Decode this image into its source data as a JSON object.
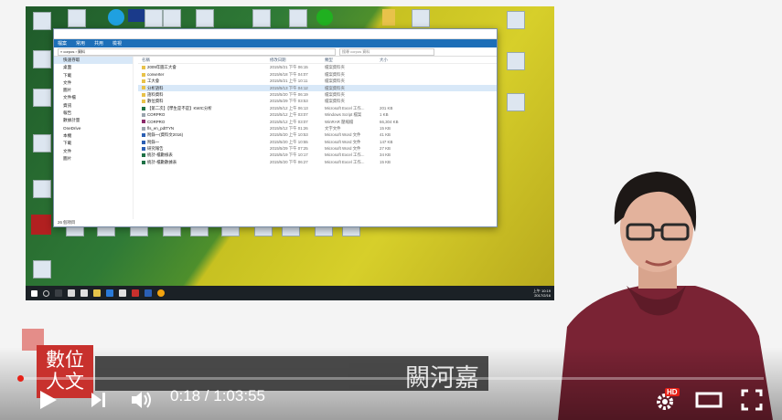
{
  "explorer": {
    "ribbon_tabs": [
      "檔案",
      "常用",
      "共用",
      "檢視"
    ],
    "address": "« corpos › 資料",
    "search_placeholder": "搜尋 corpos 資料",
    "column_headers": [
      "名稱",
      "修改日期",
      "類型",
      "大小"
    ],
    "nav_items": [
      "快速存取",
      "桌面",
      "下載",
      "文件",
      "圖片",
      "文件檔",
      "資訊",
      "報告",
      "數據計量",
      "OneDrive",
      "本機",
      "下載",
      "文件",
      "圖片"
    ],
    "files": [
      {
        "name": "2009年圖工大會",
        "date": "2015/5/21 下午 06:15",
        "type": "檔案資料夾",
        "size": ""
      },
      {
        "name": "converter",
        "date": "2015/6/18 下午 04:07",
        "type": "檔案資料夾",
        "size": ""
      },
      {
        "name": "工大會",
        "date": "2015/5/21 上午 10:11",
        "type": "檔案資料夾",
        "size": ""
      },
      {
        "name": "分析語料",
        "date": "2015/5/13 下午 04:12",
        "type": "檔案資料夾",
        "size": ""
      },
      {
        "name": "語料資料",
        "date": "2015/5/20 下午 06:19",
        "type": "檔案資料夾",
        "size": ""
      },
      {
        "name": "數位資料",
        "date": "2015/5/29 下午 03:53",
        "type": "檔案資料夾",
        "size": ""
      },
      {
        "name": "【第二次】【學生是不是】KWIC分析",
        "date": "2015/5/12 上午 06:13",
        "type": "Microsoft Excel 工作...",
        "size": "201 KB"
      },
      {
        "name": "CORPRO",
        "date": "2015/5/12 上午 03:07",
        "type": "Windows Script 檔案",
        "size": "1 KB"
      },
      {
        "name": "CORPRO",
        "date": "2015/5/12 上午 03:07",
        "type": "WinRAR 壓縮檔",
        "size": "66,304 KB"
      },
      {
        "name": "fls_en_pdtTYN",
        "date": "2015/5/12 下午 01:26",
        "type": "文字文件",
        "size": "15 KB"
      },
      {
        "name": "附錄一(資料文2016)",
        "date": "2015/5/20 上午 10:53",
        "type": "Microsoft Word 文件",
        "size": "41 KB"
      },
      {
        "name": "附錄一",
        "date": "2015/5/20 上午 10:55",
        "type": "Microsoft Word 文件",
        "size": "147 KB"
      },
      {
        "name": "研究報告",
        "date": "2015/5/29 下午 07:25",
        "type": "Microsoft Word 文件",
        "size": "27 KB"
      },
      {
        "name": "統計-檔數檢表",
        "date": "2015/5/19 下午 10:17",
        "type": "Microsoft Excel 工作...",
        "size": "34 KB"
      },
      {
        "name": "統計-檔數數據表",
        "date": "2015/5/20 下午 06:27",
        "type": "Microsoft Excel 工作...",
        "size": "15 KB"
      }
    ],
    "status_bar": "26 個項目"
  },
  "desktop_icons": [
    "Acrobat Reader DC",
    "Windows Media Player",
    "新增資料夾",
    "corpos 資料"
  ],
  "tray_clock": "上午 10:19\n2017/2/16",
  "logo_text": "數位人文",
  "presenter_name": "闕河嘉",
  "player": {
    "current_time": "0:18",
    "duration": "1:03:55",
    "time_display": "0:18 / 1:03:55",
    "progress_fraction": 0.0047,
    "hd_badge": "HD",
    "accent_color": "#e62117"
  },
  "icons": {
    "play": "play-icon",
    "next": "next-icon",
    "volume": "volume-icon",
    "settings": "gear-icon",
    "theater": "theater-icon",
    "fullscreen": "fullscreen-icon"
  }
}
